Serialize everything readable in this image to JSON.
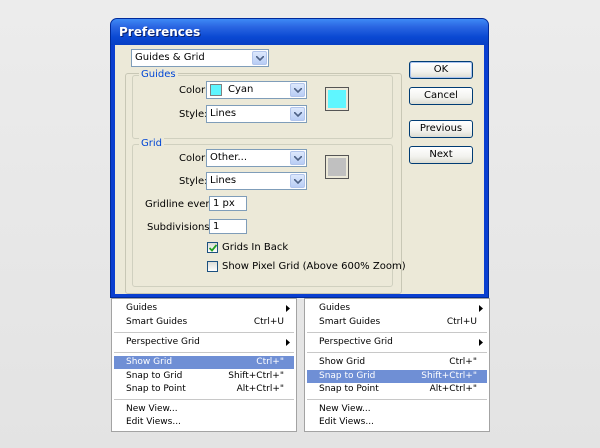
{
  "dialog": {
    "title": "Preferences",
    "section_select": "Guides & Grid",
    "guides": {
      "legend": "Guides",
      "color_label": "Color:",
      "color_value": "Cyan",
      "color_hex": "#5ff6ff",
      "style_label": "Style:",
      "style_value": "Lines"
    },
    "grid": {
      "legend": "Grid",
      "color_label": "Color:",
      "color_value": "Other...",
      "color_hex": "#c0c0c0",
      "style_label": "Style:",
      "style_value": "Lines",
      "gridline_label": "Gridline every:",
      "gridline_value": "1 px",
      "subdivisions_label": "Subdivisions:",
      "subdivisions_value": "1",
      "grids_in_back_label": "Grids In Back",
      "grids_in_back_checked": true,
      "pixel_grid_label": "Show Pixel Grid (Above 600% Zoom)",
      "pixel_grid_checked": false
    },
    "buttons": {
      "ok": "OK",
      "cancel": "Cancel",
      "previous": "Previous",
      "next": "Next"
    }
  },
  "menus": [
    {
      "highlighted": "Show Grid",
      "items": [
        {
          "label": "Guides",
          "shortcut": "",
          "submenu": true
        },
        {
          "label": "Smart Guides",
          "shortcut": "Ctrl+U",
          "submenu": false
        },
        {
          "label": "Perspective Grid",
          "shortcut": "",
          "submenu": true
        },
        {
          "label": "Show Grid",
          "shortcut": "Ctrl+\"",
          "submenu": false
        },
        {
          "label": "Snap to Grid",
          "shortcut": "Shift+Ctrl+\"",
          "submenu": false
        },
        {
          "label": "Snap to Point",
          "shortcut": "Alt+Ctrl+\"",
          "submenu": false
        },
        {
          "label": "New View...",
          "shortcut": "",
          "submenu": false
        },
        {
          "label": "Edit Views...",
          "shortcut": "",
          "submenu": false
        }
      ]
    },
    {
      "highlighted": "Snap to Grid",
      "items": [
        {
          "label": "Guides",
          "shortcut": "",
          "submenu": true
        },
        {
          "label": "Smart Guides",
          "shortcut": "Ctrl+U",
          "submenu": false
        },
        {
          "label": "Perspective Grid",
          "shortcut": "",
          "submenu": true
        },
        {
          "label": "Show Grid",
          "shortcut": "Ctrl+\"",
          "submenu": false
        },
        {
          "label": "Snap to Grid",
          "shortcut": "Shift+Ctrl+\"",
          "submenu": false
        },
        {
          "label": "Snap to Point",
          "shortcut": "Alt+Ctrl+\"",
          "submenu": false
        },
        {
          "label": "New View...",
          "shortcut": "",
          "submenu": false
        },
        {
          "label": "Edit Views...",
          "shortcut": "",
          "submenu": false
        }
      ]
    }
  ]
}
